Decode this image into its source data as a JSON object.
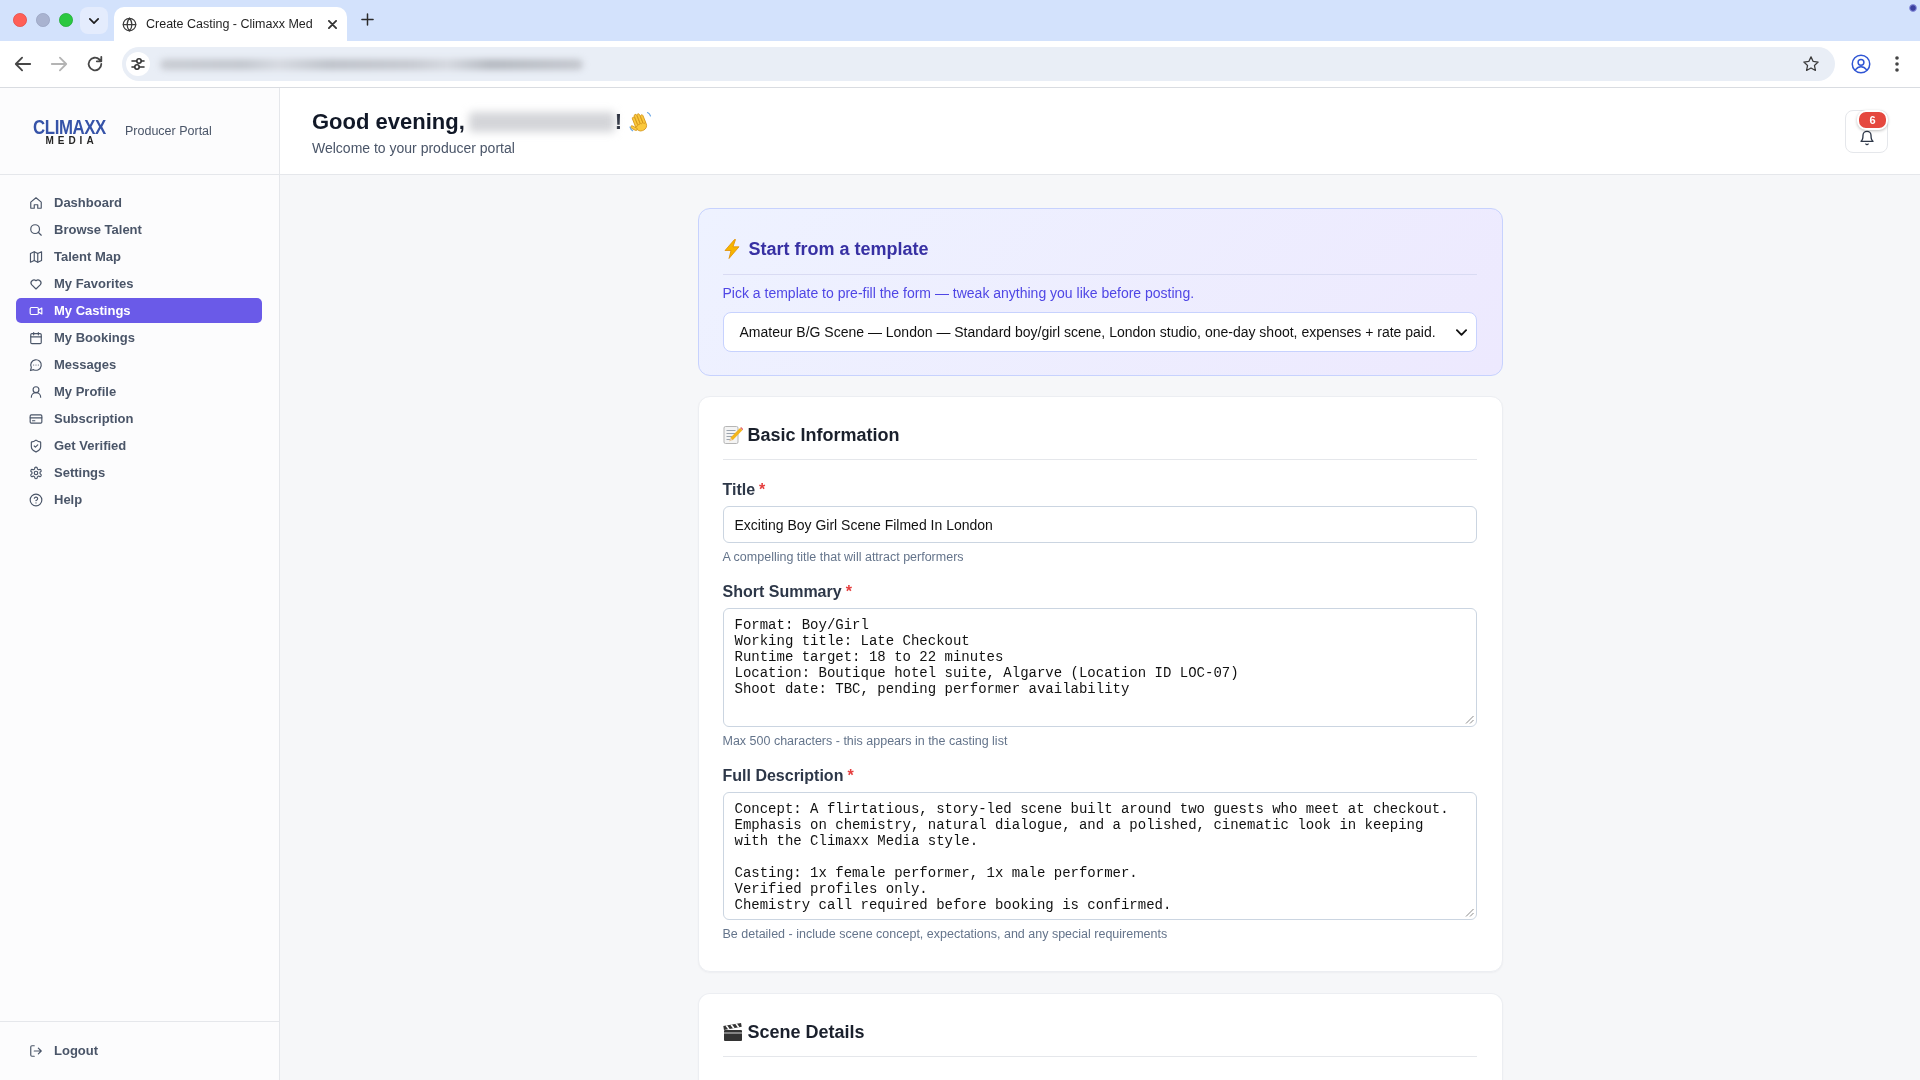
{
  "browser": {
    "tab_title": "Create Casting - Climaxx Med"
  },
  "sidebar": {
    "logo": {
      "top": "CLIMAXX",
      "bottom": "MEDIA"
    },
    "portal_label": "Producer Portal",
    "items": [
      {
        "label": "Dashboard",
        "selected": false
      },
      {
        "label": "Browse Talent",
        "selected": false
      },
      {
        "label": "Talent Map",
        "selected": false
      },
      {
        "label": "My Favorites",
        "selected": false
      },
      {
        "label": "My Castings",
        "selected": true
      },
      {
        "label": "My Bookings",
        "selected": false
      },
      {
        "label": "Messages",
        "selected": false
      },
      {
        "label": "My Profile",
        "selected": false
      },
      {
        "label": "Subscription",
        "selected": false
      },
      {
        "label": "Get Verified",
        "selected": false
      },
      {
        "label": "Settings",
        "selected": false
      },
      {
        "label": "Help",
        "selected": false
      }
    ],
    "logout": "Logout"
  },
  "header": {
    "greeting": "Good evening,",
    "greeting_end": "!",
    "subtitle": "Welcome to your producer portal",
    "notification_count": "6"
  },
  "template": {
    "title": "Start from a template",
    "hint": "Pick a template to pre-fill the form — tweak anything you like before posting.",
    "selected_template": "Amateur B/G Scene — London — Standard boy/girl scene, London studio, one-day shoot, expenses + rate paid."
  },
  "sections": [
    {
      "title": "Basic Information",
      "fields": [
        {
          "kind": "input",
          "label": "Title",
          "required_mark": "*",
          "value": "Exciting Boy Girl Scene Filmed In London",
          "help": "A compelling title that will attract performers"
        },
        {
          "kind": "textarea",
          "label": "Short Summary",
          "required_mark": "*",
          "value": "Format: Boy/Girl\nWorking title: Late Checkout\nRuntime target: 18 to 22 minutes\nLocation: Boutique hotel suite, Algarve (Location ID LOC-07)\nShoot date: TBC, pending performer availability",
          "help": "Max 500 characters - this appears in the casting list"
        },
        {
          "kind": "textarea",
          "label": "Full Description",
          "required_mark": "*",
          "value": "Concept: A flirtatious, story-led scene built around two guests who meet at checkout.\nEmphasis on chemistry, natural dialogue, and a polished, cinematic look in keeping\nwith the Climaxx Media style.\n\nCasting: 1x female performer, 1x male performer.\nVerified profiles only.\nChemistry call required before booking is confirmed.",
          "help": "Be detailed - include scene concept, expectations, and any special requirements"
        }
      ]
    },
    {
      "title": "Scene Details"
    }
  ]
}
